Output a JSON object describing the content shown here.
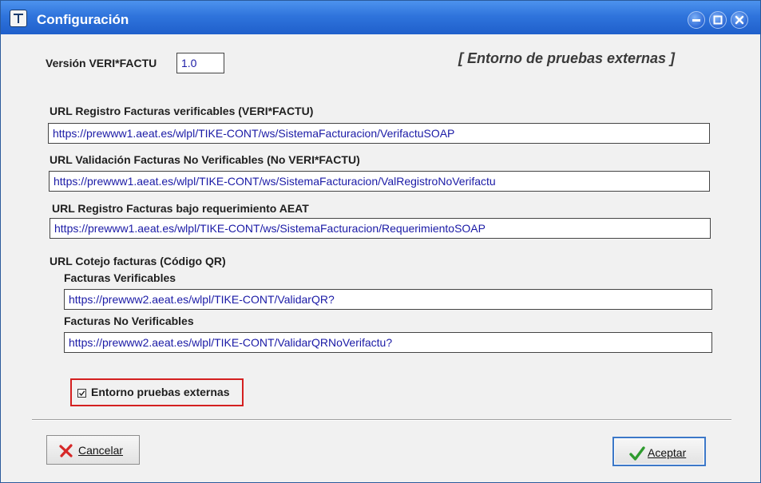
{
  "window": {
    "title": "Configuración"
  },
  "form": {
    "version_label": "Versión VERI*FACTU",
    "version_value": "1.0",
    "environment_banner": "[ Entorno de pruebas externas ]",
    "url_registro_label": "URL Registro Facturas verificables (VERI*FACTU)",
    "url_registro_value": "https://prewww1.aeat.es/wlpl/TIKE-CONT/ws/SistemaFacturacion/VerifactuSOAP",
    "url_validacion_label": "URL Validación Facturas No Verificables (No VERI*FACTU)",
    "url_validacion_value": "https://prewww1.aeat.es/wlpl/TIKE-CONT/ws/SistemaFacturacion/ValRegistroNoVerifactu",
    "url_requerimiento_label": "URL Registro Facturas bajo requerimiento AEAT",
    "url_requerimiento_value": "https://prewww1.aeat.es/wlpl/TIKE-CONT/ws/SistemaFacturacion/RequerimientoSOAP",
    "qr_section_label": "URL Cotejo facturas (Código QR)",
    "qr_verificables_label": "Facturas Verificables",
    "qr_verificables_value": "https://prewww2.aeat.es/wlpl/TIKE-CONT/ValidarQR?",
    "qr_no_verificables_label": "Facturas No Verificables",
    "qr_no_verificables_value": "https://prewww2.aeat.es/wlpl/TIKE-CONT/ValidarQRNoVerifactu?",
    "test_env_checkbox_label": "Entorno pruebas externas",
    "test_env_checked": true
  },
  "buttons": {
    "cancel_label": "Cancelar",
    "ok_label": "Aceptar"
  },
  "icons": {
    "app": "app-icon",
    "minimize": "minimize-icon",
    "maximize": "maximize-icon",
    "close": "close-icon",
    "cancel": "red-x-icon",
    "ok": "green-check-icon"
  },
  "colors": {
    "titlebar": "#2f74dc",
    "field_text": "#1a1aa6",
    "highlight_box": "#d42020"
  }
}
